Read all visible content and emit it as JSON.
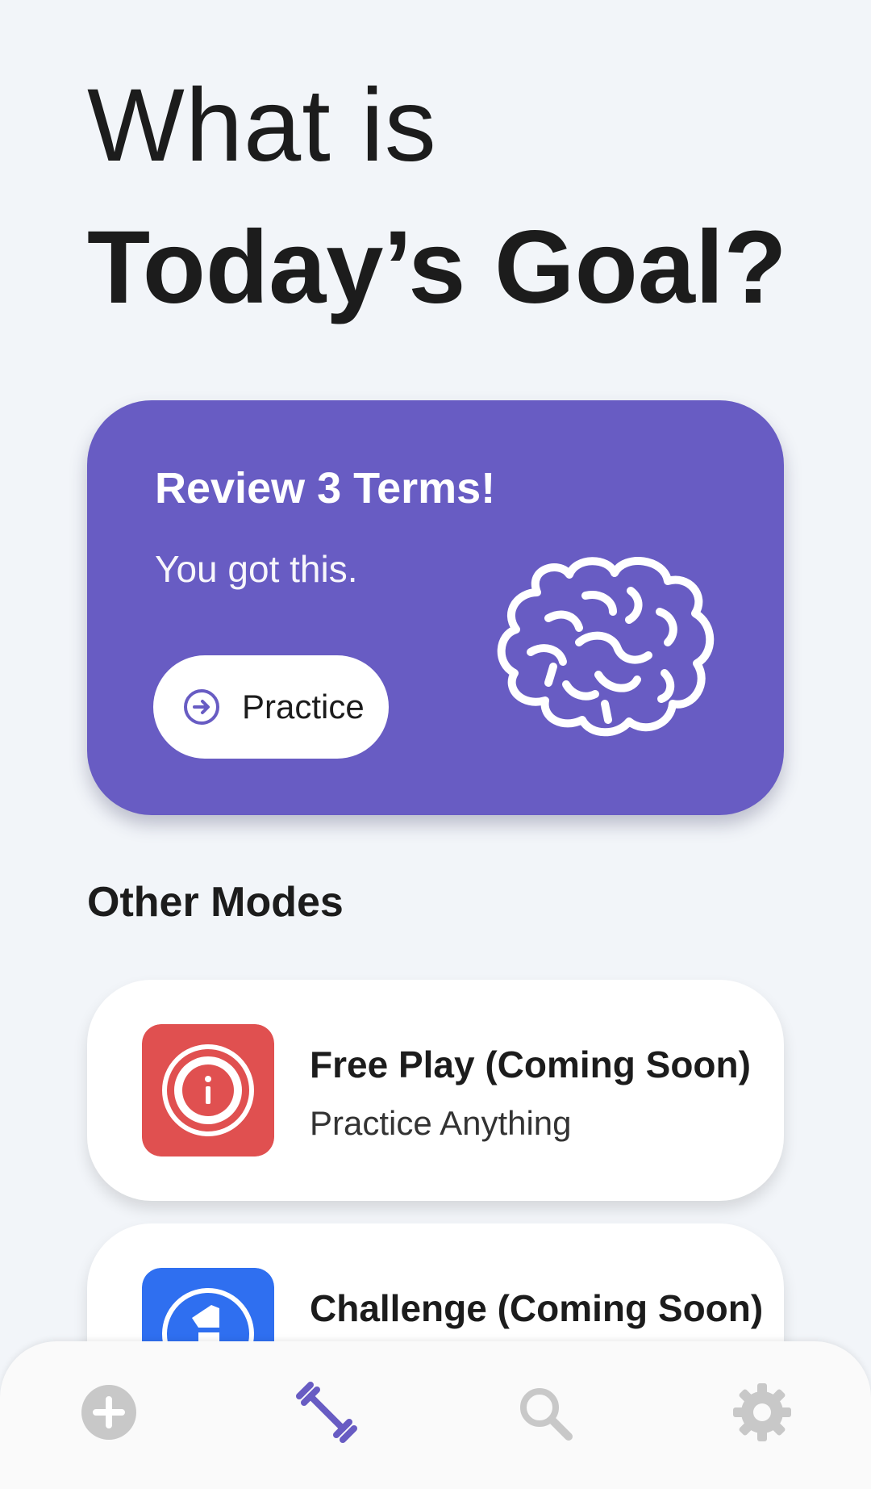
{
  "header": {
    "line1": "What is",
    "line2": "Today’s Goal?"
  },
  "goal_card": {
    "title": "Review 3 Terms!",
    "subtitle": "You got this.",
    "button_label": "Practice",
    "button_icon": "arrow-right-circle-icon",
    "illustration": "brain-icon",
    "background_color": "#685cc3"
  },
  "other_modes": {
    "section_title": "Other Modes",
    "items": [
      {
        "title": "Free Play (Coming Soon)",
        "subtitle": "Practice Anything",
        "icon": "info-icon",
        "icon_color": "#e05050"
      },
      {
        "title": "Challenge (Coming Soon)",
        "subtitle": "",
        "icon": "chess-pawn-icon",
        "icon_color": "#2f6ff0"
      }
    ]
  },
  "bottom_nav": {
    "items": [
      {
        "name": "add",
        "icon": "plus-circle-icon",
        "active": false
      },
      {
        "name": "practice",
        "icon": "dumbbell-icon",
        "active": true
      },
      {
        "name": "search",
        "icon": "search-icon",
        "active": false
      },
      {
        "name": "settings",
        "icon": "gear-icon",
        "active": false
      }
    ],
    "active_color": "#685cc3",
    "inactive_color": "#c8c8c8"
  }
}
